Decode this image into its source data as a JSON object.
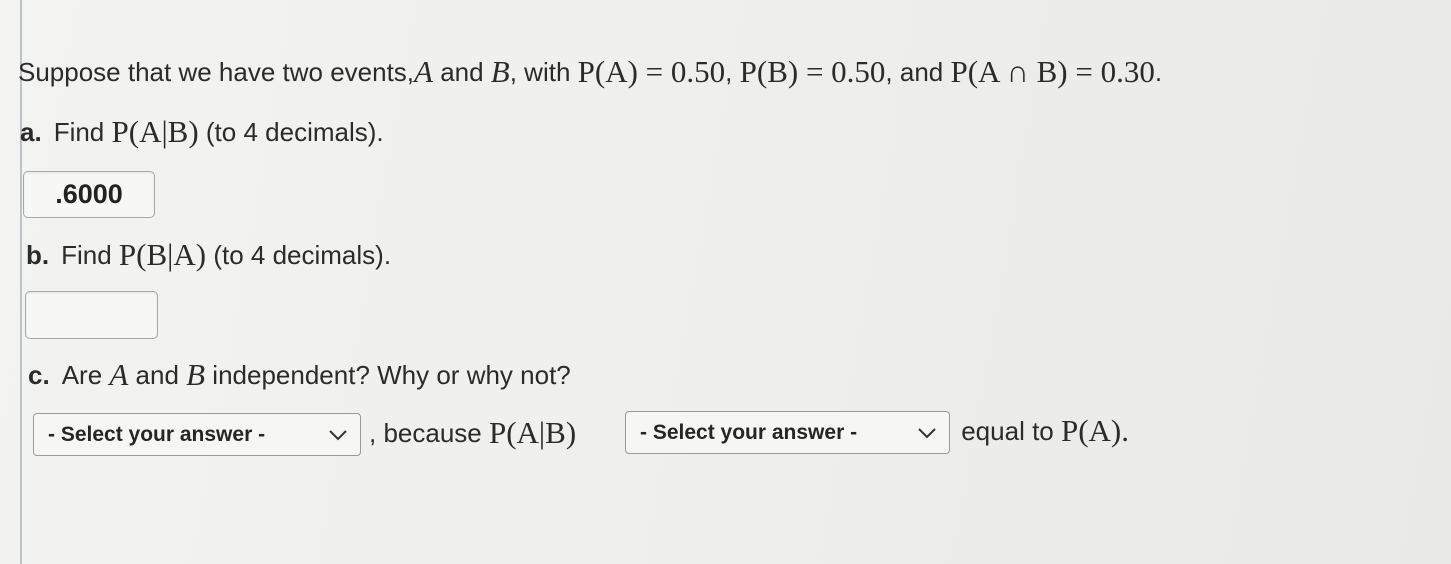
{
  "question": {
    "intro": "Suppose that we have two events, ",
    "event_a": "A",
    "and1": " and ",
    "event_b": "B",
    "with": ", with ",
    "pa": "P(A) = 0.50",
    "sep1": ", ",
    "pb": "P(B) = 0.50",
    "and2": ", and ",
    "pab": "P(A ∩ B) = 0.30",
    "end": "."
  },
  "part_a": {
    "label": "a.",
    "find": "Find ",
    "expr": "P(A|B)",
    "note": " (to 4 decimals).",
    "answer_value": ".6000"
  },
  "part_b": {
    "label": "b.",
    "find": "Find ",
    "expr": "P(B|A)",
    "note": " (to 4 decimals).",
    "answer_value": ""
  },
  "part_c": {
    "label": "c.",
    "are": "Are ",
    "a": "A",
    "and": " and ",
    "b": "B",
    "rest": " independent? Why or why not?",
    "select1_value": "- Select your answer -",
    "because": ", because ",
    "expr": "P(A|B)",
    "select2_value": "- Select your answer -",
    "equal_to": " equal to ",
    "pa_expr": "P(A)",
    "end": "."
  },
  "icons": {
    "select_arrow": "chevron-down-icon"
  }
}
